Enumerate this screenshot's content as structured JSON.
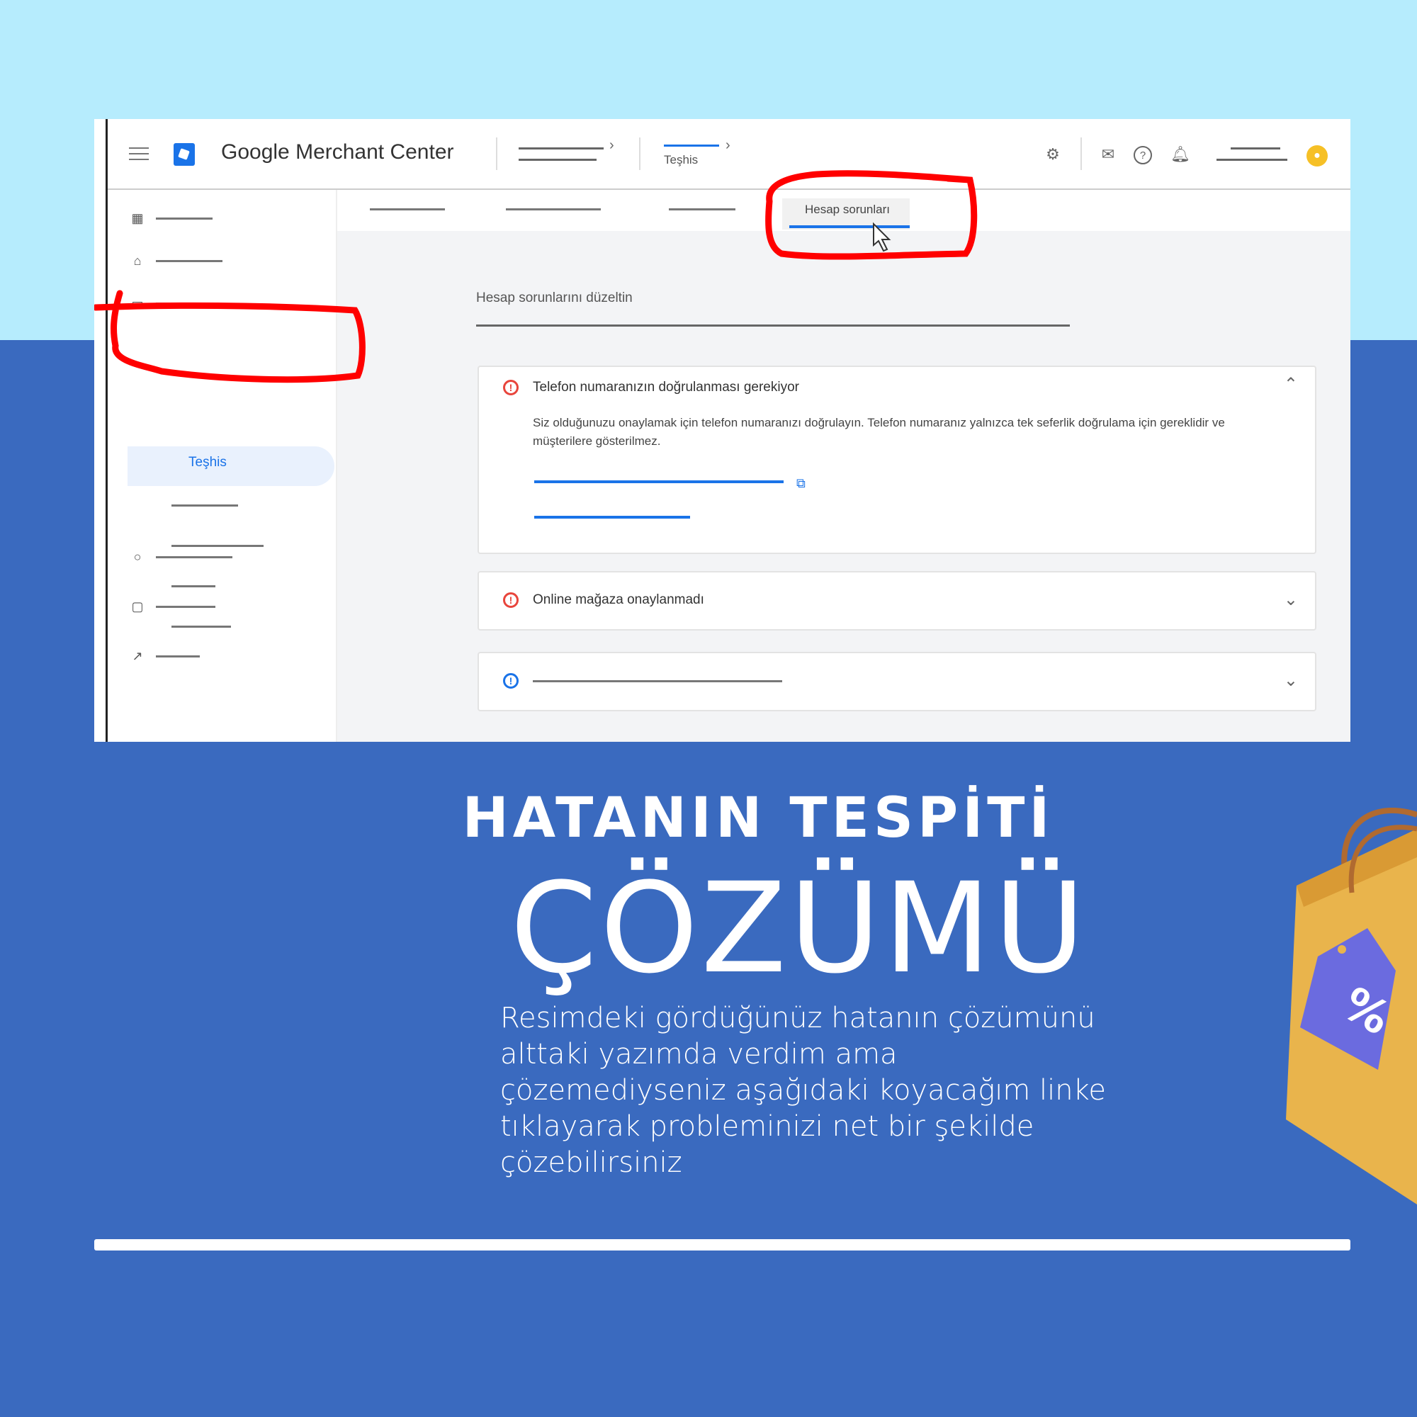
{
  "app": {
    "title": "Google Merchant Center",
    "breadcrumb_active": "Teşhis"
  },
  "sidebar": {
    "selected_label": "Teşhis"
  },
  "tabs": {
    "active_label": "Hesap sorunları"
  },
  "main": {
    "section_title": "Hesap sorunlarını düzeltin",
    "issues": [
      {
        "title": "Telefon numaranızın doğrulanması gerekiyor",
        "body": "Siz olduğunuzu onaylamak için telefon numaranızı doğrulayın. Telefon numaranız yalnızca tek seferlik doğrulama için gereklidir ve müşterilere gösterilmez.",
        "expanded": true
      },
      {
        "title": "Online mağaza onaylanmadı",
        "expanded": false
      },
      {
        "title": "",
        "expanded": false
      }
    ]
  },
  "poster": {
    "headline": "HATANIN TESPİTİ",
    "big_title": "ÇÖZÜMÜ",
    "description": "Resimdeki gördüğünüz hatanın çözümünü alttaki yazımda verdim ama çözemediyseniz aşağıdaki koyacağım linke tıklayarak probleminizi net bir şekilde çözebilirsiniz",
    "bag_badge": "%"
  },
  "colors": {
    "sky": "#b6ecfd",
    "brand_blue": "#3a6abf",
    "accent_blue": "#1a73e8",
    "marker_red": "#ff0000",
    "error_red": "#e8453c",
    "bag_yellow": "#e9b44c",
    "tag_purple": "#6b6bdf"
  },
  "icons": [
    "menu-icon",
    "merchant-logo-icon",
    "settings-icon",
    "mail-icon",
    "help-icon",
    "bell-icon",
    "account-icon",
    "error-icon",
    "info-icon",
    "chevron-up-icon",
    "chevron-down-icon",
    "external-link-icon",
    "cursor-icon",
    "shopping-bag-icon"
  ]
}
